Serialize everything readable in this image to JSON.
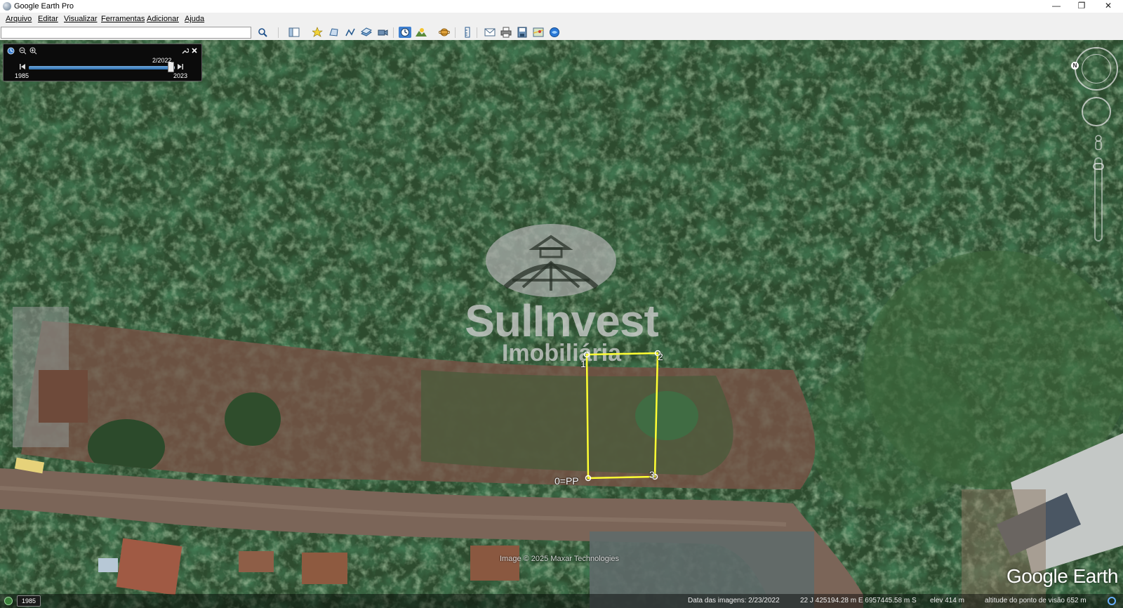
{
  "window": {
    "title": "Google Earth Pro",
    "minimize_glyph": "—",
    "restore_glyph": "❐",
    "close_glyph": "✕"
  },
  "menu": {
    "items": [
      {
        "label": "Arquivo"
      },
      {
        "label": "Editar"
      },
      {
        "label": "Visualizar"
      },
      {
        "label": "Ferramentas"
      },
      {
        "label": "Adicionar"
      },
      {
        "label": "Ajuda"
      }
    ]
  },
  "search": {
    "value": "",
    "placeholder": ""
  },
  "toolbar": {
    "icons": [
      "search-icon",
      "sidebar-toggle-icon",
      "add-placemark-icon",
      "add-polygon-icon",
      "add-path-icon",
      "add-image-overlay-icon",
      "record-tour-icon",
      "historical-imagery-icon",
      "sunlight-icon",
      "switch-planet-icon",
      "ruler-icon",
      "email-icon",
      "print-icon",
      "save-image-icon",
      "view-in-maps-icon",
      "sign-in-icon"
    ],
    "active": [
      "historical-imagery-icon"
    ]
  },
  "time_slider": {
    "start_year": "1985",
    "end_year": "2023",
    "current_date": "2/2022",
    "position_fraction": 0.97
  },
  "map": {
    "watermark_name": "SulInvest",
    "watermark_subtitle": "Imobiliária",
    "plot_labels": {
      "p0": "0=PP",
      "p1": "1",
      "p2": "2",
      "p3": "3"
    },
    "imagery_credit": "Image © 2025 Maxar Technologies",
    "logo": "Google Earth",
    "north_label": "N"
  },
  "status": {
    "year_badge": "1985",
    "imagery_date": "Data das imagens: 2/23/2022",
    "coordinates": "22 J 425194.28 m E 6957445.58 m S",
    "elevation": "elev  414 m",
    "eye_altitude": "altitude do ponto de visão   652 m"
  },
  "colors": {
    "accent": "#3d7fd0",
    "boundary": "#ffff33",
    "foliage": "#2a4a2c",
    "soil": "#6a5140"
  }
}
